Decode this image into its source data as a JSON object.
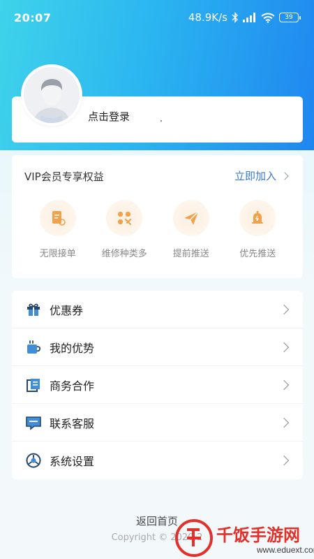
{
  "status_bar": {
    "time": "20:07",
    "network_speed": "48.9K/s",
    "battery": "39",
    "icons": [
      "bluetooth-icon",
      "signal-icon",
      "wifi-icon",
      "battery-icon"
    ]
  },
  "profile": {
    "login_label": "点击登录",
    "avatar": "default-avatar"
  },
  "vip": {
    "title": "VIP会员专享权益",
    "join_label": "立即加入",
    "benefits": [
      {
        "label": "无限接单",
        "icon": "document-icon"
      },
      {
        "label": "维修种类多",
        "icon": "tools-icon"
      },
      {
        "label": "提前推送",
        "icon": "paper-plane-icon"
      },
      {
        "label": "优先推送",
        "icon": "bell-icon"
      }
    ]
  },
  "menu": {
    "items": [
      {
        "label": "优惠券",
        "icon": "gift-icon"
      },
      {
        "label": "我的优势",
        "icon": "cup-icon"
      },
      {
        "label": "商务合作",
        "icon": "documents-icon"
      },
      {
        "label": "联系客服",
        "icon": "message-icon"
      },
      {
        "label": "系统设置",
        "icon": "settings-icon"
      }
    ]
  },
  "footer": {
    "home_link": "返回首页",
    "copyright": "Copyright © 2020-2"
  },
  "watermark": {
    "brand": "千饭手游网",
    "url": "www.eduext.com"
  },
  "colors": {
    "gradient_start": "#3fd3ea",
    "gradient_end": "#1f86f0",
    "link_blue": "#3a79c9",
    "benefit_accent": "#f0a24b",
    "icon_navy": "#25476b",
    "icon_blue": "#3f8ed6"
  }
}
